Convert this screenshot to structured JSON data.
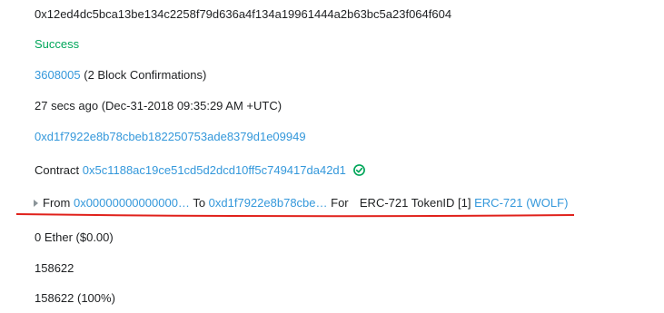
{
  "tx_hash": "0x12ed4dc5bca13be134c2258f79d636a4f134a19961444a2b63bc5a23f064f604",
  "status": "Success",
  "block": {
    "number": "3608005",
    "confirmations": "(2 Block Confirmations)"
  },
  "timestamp": "27 secs ago (Dec-31-2018 09:35:29 AM +UTC)",
  "from_address": "0xd1f7922e8b78cbeb182250753ade8379d1e09949",
  "contract": {
    "label": "Contract",
    "address": "0x5c1188ac19ce51cd5d2dcd10ff5c749417da42d1"
  },
  "transfer": {
    "from_label": "From",
    "from": "0x00000000000000…",
    "to_label": "To",
    "to": "0xd1f7922e8b78cbe…",
    "for_label": "For",
    "token_text": "ERC-721 TokenID [1]",
    "token_link": "ERC-721 (WOLF)"
  },
  "value": "0 Ether ($0.00)",
  "gas_limit": "158622",
  "gas_used": "158622 (100%)",
  "colors": {
    "link": "#3498db",
    "success": "#00a65a",
    "underline": "#e0211b"
  }
}
